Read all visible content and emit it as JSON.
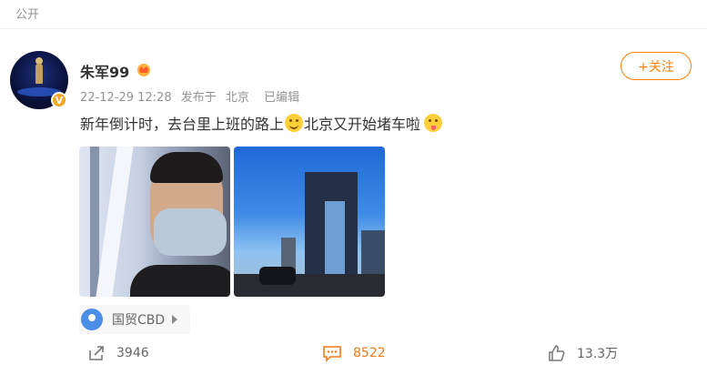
{
  "header": {
    "visibility": "公开"
  },
  "post": {
    "username": "朱军99",
    "timestamp": "22-12-29 12:28",
    "source_prefix": "发布于",
    "location_meta": "北京",
    "edited": "已编辑",
    "text_part1": "新年倒计时，去台里上班的路上",
    "text_part2": "北京又开始堵车啦",
    "location_tag": "国贸CBD"
  },
  "follow_button": {
    "label": "+关注"
  },
  "actions": {
    "repost_count": "3946",
    "comment_count": "8522",
    "like_count": "13.3万"
  },
  "colors": {
    "accent": "#ff8200",
    "verified": "#f5a623",
    "comment": "#f27b19"
  },
  "icons": [
    "avatar",
    "verified-badge",
    "crown-icon",
    "smile-emoji",
    "tongue-emoji",
    "location-pin-icon",
    "share-icon",
    "comment-icon",
    "like-icon"
  ]
}
